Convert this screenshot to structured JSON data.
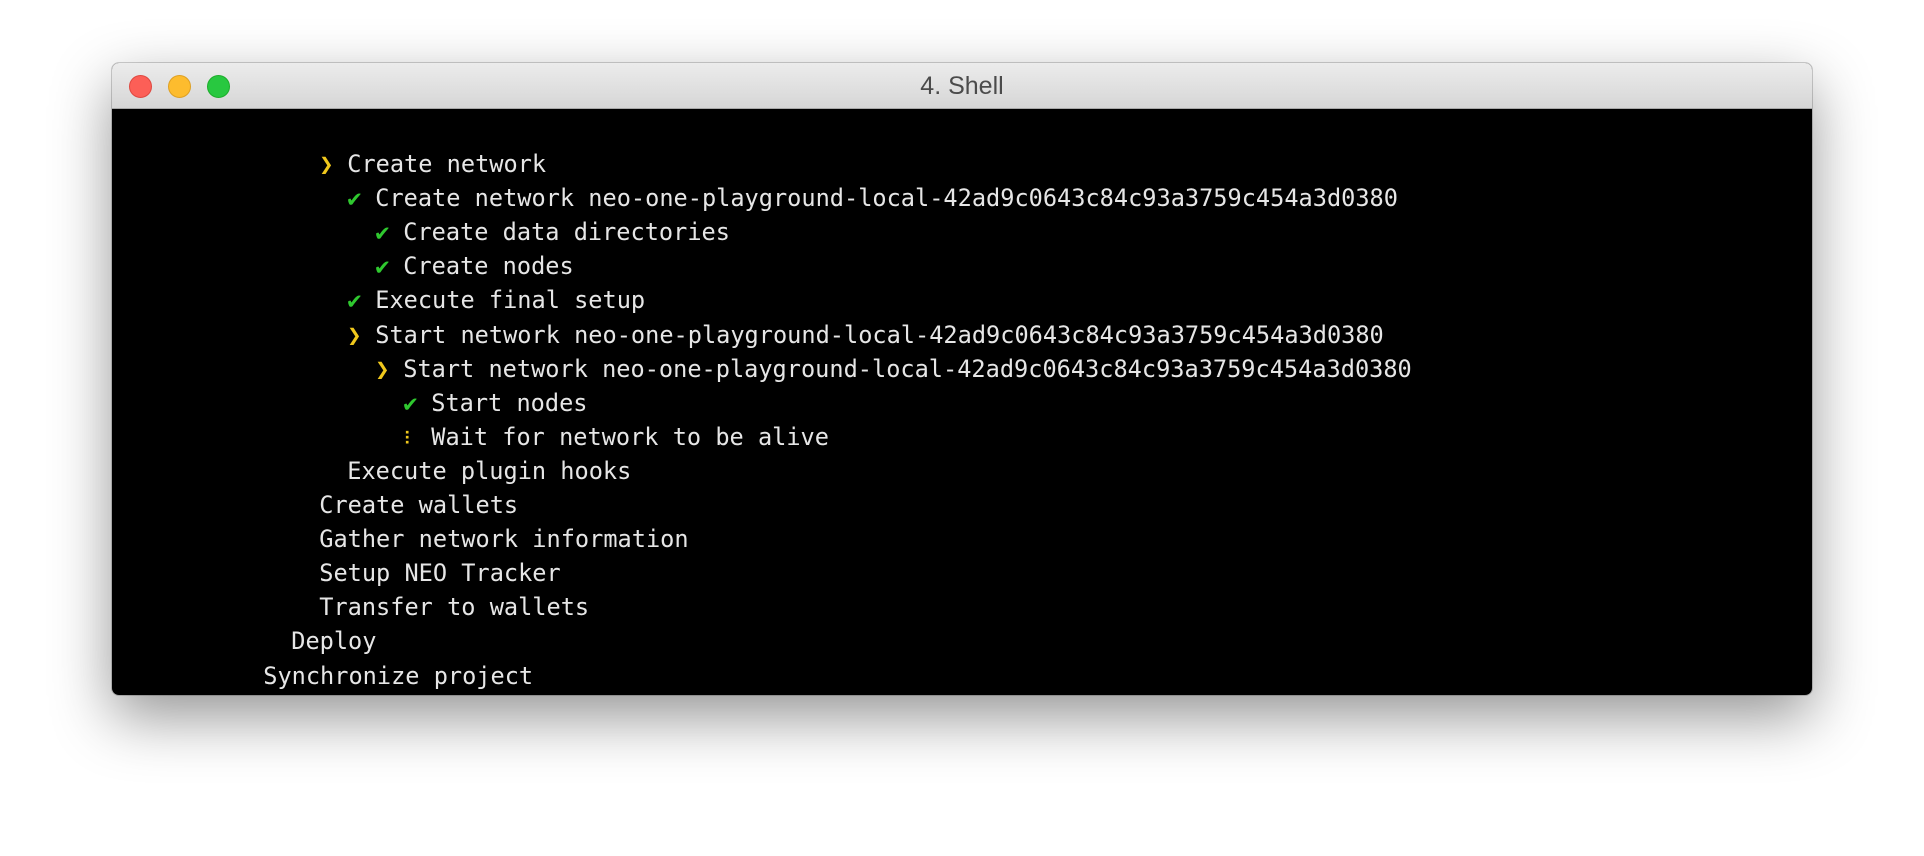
{
  "window": {
    "title": "4. Shell"
  },
  "icons": {
    "check": "✔",
    "arrow": "❯",
    "spinner": "⠇"
  },
  "colors": {
    "success": "#2fc82f",
    "active": "#f0c81c",
    "text": "#e6e6e6",
    "background": "#000000"
  },
  "lines": [
    {
      "status": "active",
      "text": "Create network"
    },
    {
      "status": "done",
      "text": "Create network neo-one-playground-local-42ad9c0643c84c93a3759c454a3d0380"
    },
    {
      "status": "done",
      "text": "Create data directories"
    },
    {
      "status": "done",
      "text": "Create nodes"
    },
    {
      "status": "done",
      "text": "Execute final setup"
    },
    {
      "status": "active",
      "text": "Start network neo-one-playground-local-42ad9c0643c84c93a3759c454a3d0380"
    },
    {
      "status": "active",
      "text": "Start network neo-one-playground-local-42ad9c0643c84c93a3759c454a3d0380"
    },
    {
      "status": "done",
      "text": "Start nodes"
    },
    {
      "status": "running",
      "text": "Wait for network to be alive"
    },
    {
      "status": "pending",
      "text": "Execute plugin hooks"
    },
    {
      "status": "pending",
      "text": "Create wallets"
    },
    {
      "status": "pending",
      "text": "Gather network information"
    },
    {
      "status": "pending",
      "text": "Setup NEO Tracker"
    },
    {
      "status": "pending",
      "text": "Transfer to wallets"
    },
    {
      "status": "pending",
      "text": "Deploy"
    },
    {
      "status": "pending",
      "text": "Synchronize project"
    }
  ]
}
